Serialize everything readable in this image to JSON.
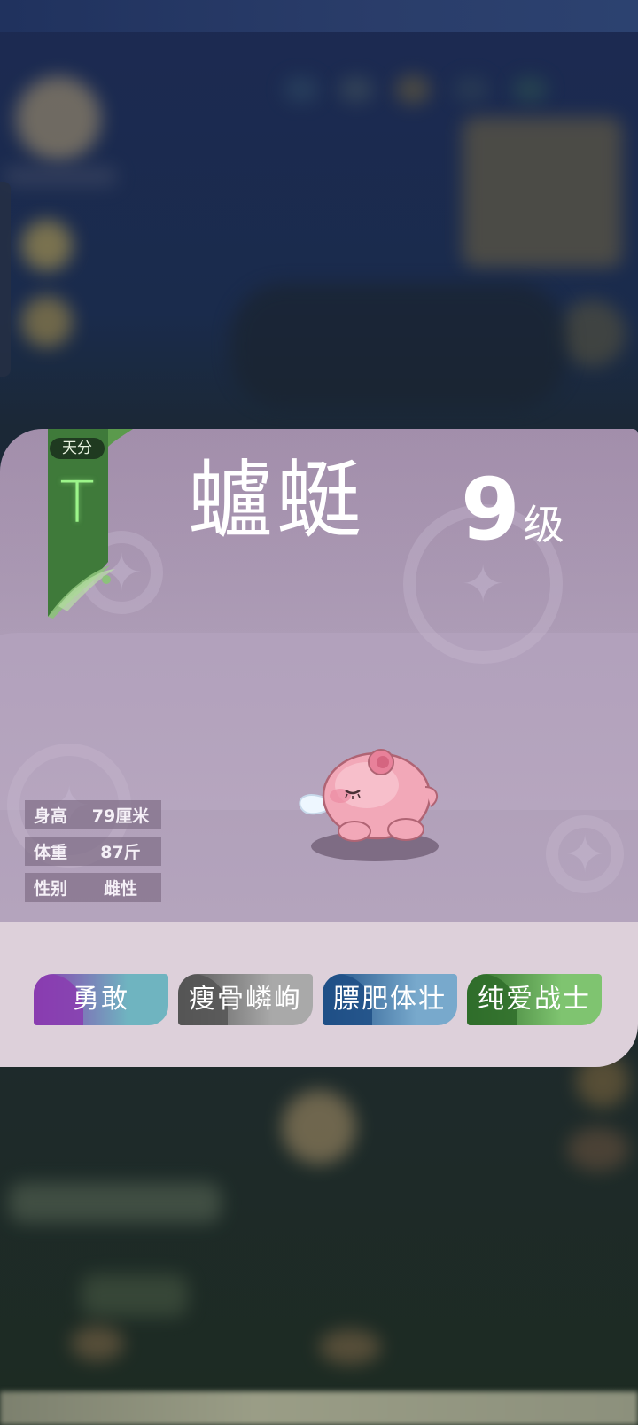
{
  "talent": {
    "label": "天分",
    "grade": "T"
  },
  "pet": {
    "name": "蠦蜓",
    "level": "9",
    "level_unit": "级"
  },
  "stats": [
    {
      "key": "身高",
      "value": "79厘米"
    },
    {
      "key": "体重",
      "value": "87斤"
    },
    {
      "key": "性别",
      "value": "雌性"
    }
  ],
  "traits": [
    {
      "label": "勇敢",
      "color_a": "#8a3cb0",
      "color_b": "#6fb4c0"
    },
    {
      "label": "瘦骨嶙峋",
      "color_a": "#555555",
      "color_b": "#a9a9a9"
    },
    {
      "label": "膘肥体壮",
      "color_a": "#1e4f86",
      "color_b": "#78a9cc"
    },
    {
      "label": "纯爱战士",
      "color_a": "#2f6d2a",
      "color_b": "#7fc470"
    }
  ],
  "colors": {
    "card_top": "#a996b1",
    "card_bottom_panel": "#ddd0da",
    "talent_ribbon": "#3f7a3a",
    "talent_grade": "#9cf58a"
  }
}
